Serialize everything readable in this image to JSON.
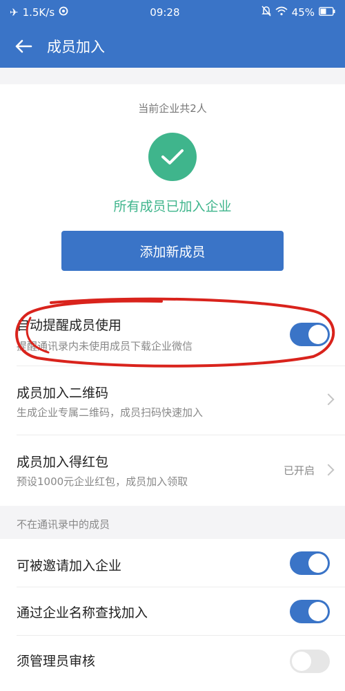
{
  "status_bar": {
    "network_speed": "1.5K/s",
    "time": "09:28",
    "battery": "45%",
    "icons": [
      "airplane-icon",
      "data-saver-icon",
      "mute-icon",
      "wifi-icon",
      "battery-icon"
    ]
  },
  "header": {
    "title": "成员加入",
    "back_icon": "back-arrow-icon"
  },
  "summary": {
    "member_count": "当前企业共2人",
    "status": "所有成员已加入企业",
    "add_button_label": "添加新成员"
  },
  "settings": [
    {
      "title": "自动提醒成员使用",
      "subtitle": "提醒通讯录内未使用成员下载企业微信",
      "control": "toggle",
      "on": true
    },
    {
      "title": "成员加入二维码",
      "subtitle": "生成企业专属二维码，成员扫码快速加入",
      "control": "chevron"
    },
    {
      "title": "成员加入得红包",
      "subtitle": "预设1000元企业红包，成员加入领取",
      "status": "已开启",
      "control": "chevron"
    }
  ],
  "section_not_in_contacts": {
    "label": "不在通讯录中的成员",
    "items": [
      {
        "title": "可被邀请加入企业",
        "control": "toggle",
        "on": true
      },
      {
        "title": "通过企业名称查找加入",
        "control": "toggle",
        "on": true
      },
      {
        "title": "须管理员审核",
        "control": "toggle",
        "on": false
      }
    ]
  },
  "colors": {
    "primary": "#3a74c7",
    "success": "#3fb58c",
    "annotation": "#d9231c",
    "background": "#f4f4f6"
  }
}
